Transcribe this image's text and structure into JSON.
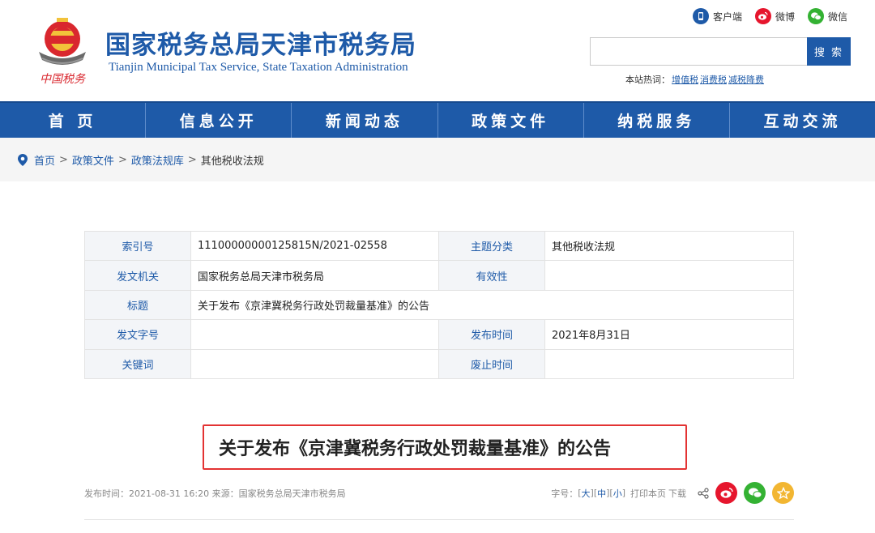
{
  "header": {
    "title": "国家税务总局天津市税务局",
    "subtitle": "Tianjin Municipal Tax Service, State Taxation Administration",
    "logo_text": "中国税务",
    "top_links": {
      "client": "客户端",
      "weibo": "微博",
      "wechat": "微信"
    },
    "search": {
      "placeholder": "",
      "button": "搜 索"
    },
    "hot": {
      "label": "本站热词：",
      "items": [
        "增值税",
        "消费税",
        "减税降费"
      ]
    }
  },
  "nav": [
    "首 页",
    "信息公开",
    "新闻动态",
    "政策文件",
    "纳税服务",
    "互动交流"
  ],
  "breadcrumb": {
    "items": [
      "首页",
      "政策文件",
      "政策法规库"
    ],
    "current": "其他税收法规",
    "sep": ">"
  },
  "info": {
    "index_label": "索引号",
    "index_value": "11100000000125815N/2021-02558",
    "topic_label": "主题分类",
    "topic_value": "其他税收法规",
    "issuer_label": "发文机关",
    "issuer_value": "国家税务总局天津市税务局",
    "validity_label": "有效性",
    "validity_value": "",
    "title_label": "标题",
    "title_value": "关于发布《京津冀税务行政处罚裁量基准》的公告",
    "docno_label": "发文字号",
    "docno_value": "",
    "pubdate_label": "发布时间",
    "pubdate_value": "2021年8月31日",
    "keyword_label": "关键词",
    "keyword_value": "",
    "abolish_label": "废止时间",
    "abolish_value": ""
  },
  "article": {
    "title": "关于发布《京津冀税务行政处罚裁量基准》的公告",
    "meta": "发布时间：2021-08-31 16:20 来源：国家税务总局天津市税务局",
    "font_label": "字号：",
    "font_large": "大",
    "font_medium": "中",
    "font_small": "小",
    "print": "打印本页",
    "download": "下载"
  },
  "colors": {
    "brand": "#1e5aa8",
    "highlight": "#e33333",
    "weibo": "#e6162d",
    "wechat": "#34b233",
    "favorite": "#f2b632"
  }
}
